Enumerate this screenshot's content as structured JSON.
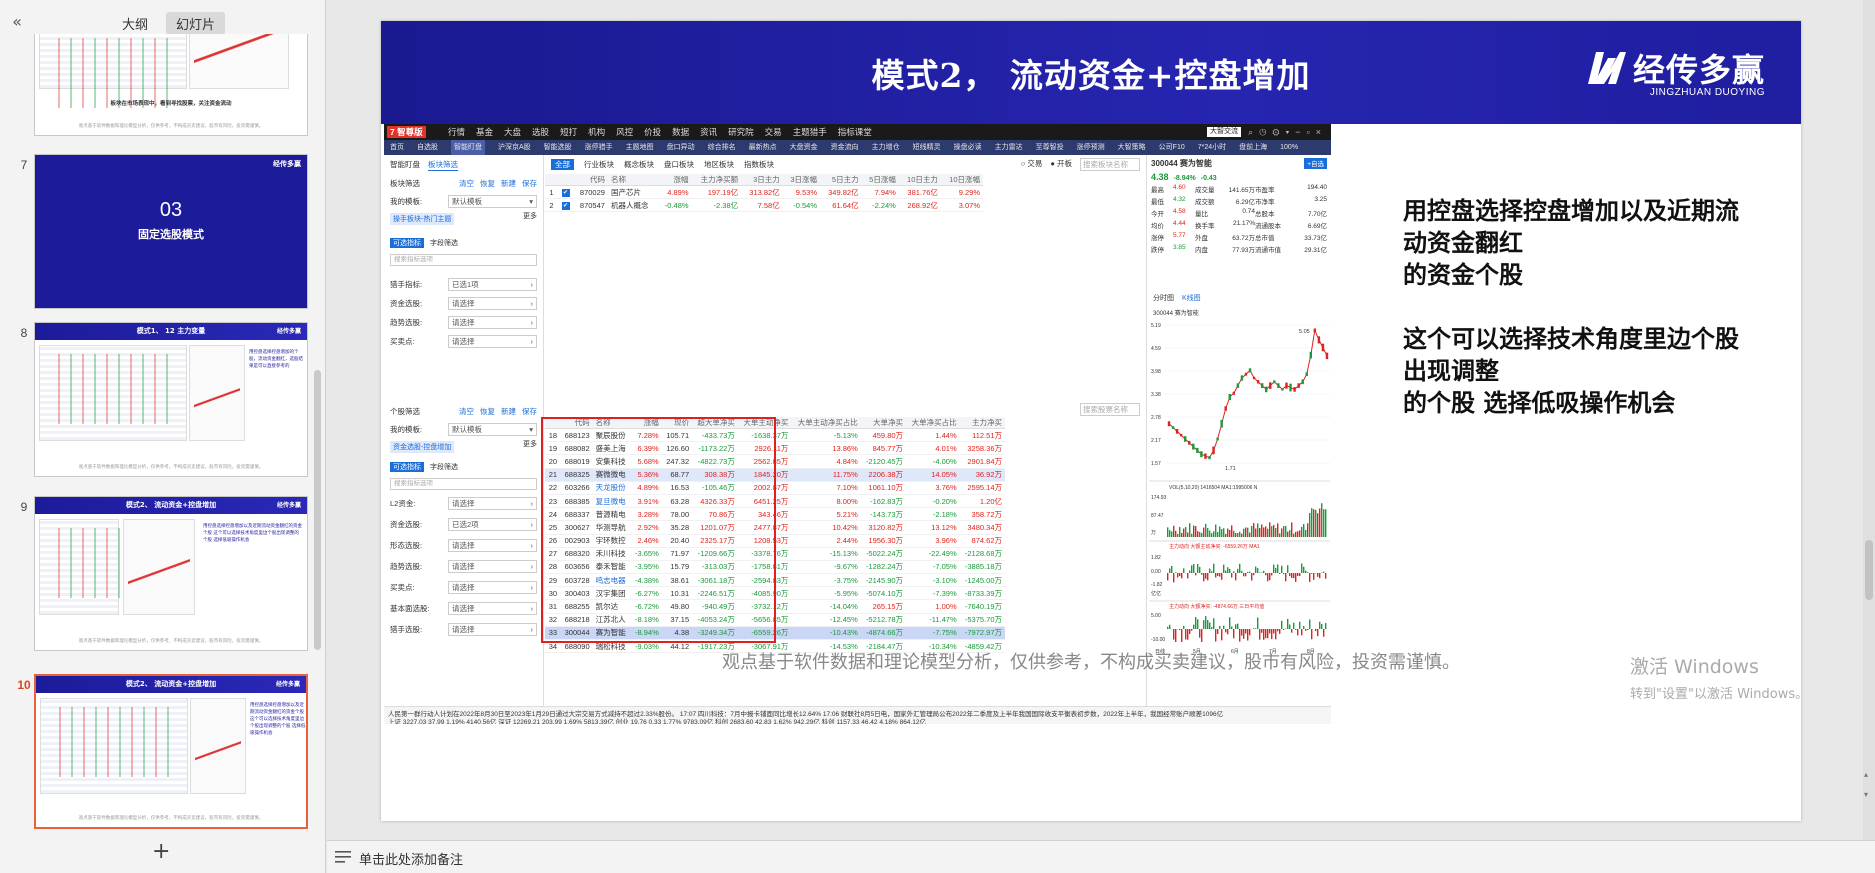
{
  "left_panel": {
    "tabs": [
      {
        "label": "大纲"
      },
      {
        "label": "幻灯片"
      }
    ],
    "thumbs": [
      {
        "num": "",
        "caption": "板块在市场表现中，看到寻找股票，关注资金流动",
        "foot": "观点基于软件数据和理论模型分析，仅供参考，不构成买卖建议，股市有风险，投资需谨慎。"
      },
      {
        "num": "7",
        "big_number": "03",
        "big_title": "固定选股模式",
        "brand": "经传多赢"
      },
      {
        "num": "8",
        "title": "模式1、 12 主力变量",
        "brand": "经传多赢",
        "side_text": "用控盘选择控盘增加的个股，流动资金翻红，选股结果是可以直接参考的",
        "foot": "观点基于软件数据和理论模型分析，仅供参考，不构成买卖建议，股市有风险，投资需谨慎。"
      },
      {
        "num": "9",
        "title": "模式2、 流动资金+控盘增加",
        "brand": "经传多赢",
        "side_text": "用控盘选择控盘增加以及近期流动资金翻红的资金个股 这个可以选择技术角度里边个股出现调整的个股 选择低吸操作机会",
        "foot": "观点基于软件数据和理论模型分析，仅供参考，不构成买卖建议，股市有风险，投资需谨慎。"
      },
      {
        "num": "10",
        "title": "模式2、 流动资金+控盘增加",
        "brand": "经传多赢",
        "side_text": "用控盘选择控盘增加以及近期流动资金翻红的资金个股 这个可以选择技术角度里边个股出现调整的个股 选择低吸操作机会",
        "foot": "观点基于软件数据和理论模型分析，仅供参考，不构成买卖建议，股市有风险，投资需谨慎。"
      }
    ],
    "add_slide": "+",
    "collapse": "«"
  },
  "slide": {
    "title": "模式2，  流动资金+控盘增加",
    "brand_cn": "经传多赢",
    "brand_en": "JINGZHUAN DUOYING",
    "text_p1": [
      "用控盘选择控盘增加以及近期流",
      "动资金翻红",
      "的资金个股"
    ],
    "text_p2": [
      "这个可以选择技术角度里边个股",
      "出现调整",
      "的个股  选择低吸操作机会"
    ],
    "disclaimer": "观点基于软件数据和理论模型分析，仅供参考，不构成买卖建议，股市有风险，投资需谨慎。"
  },
  "software": {
    "logo": "7 智尊版",
    "menu": [
      "行情",
      "基金",
      "大盘",
      "选股",
      "短打",
      "机构",
      "风控",
      "价投",
      "数据",
      "资讯",
      "研究院",
      "交易",
      "主题猎手",
      "指标课堂"
    ],
    "badge": "大智交流",
    "toolbar": [
      "首页",
      "自选股",
      "智能盯盘",
      "沪深京A股",
      "智能选股",
      "涨停猎手",
      "主题地图",
      "盘口异动",
      "综合排名",
      "最新热点",
      "大盘资金",
      "资金流向",
      "主力增仓",
      "短线精灵",
      "操盘必读",
      "主力雷达",
      "至尊智投",
      "涨停预测",
      "大智策略",
      "公司F10",
      "7*24小时",
      "盘前上海",
      "100%"
    ],
    "left_subtabs": [
      "智能盯盘",
      "板块筛选"
    ],
    "sector_section": {
      "title": "板块筛选",
      "links": [
        "清空",
        "恢复",
        "新建",
        "保存"
      ]
    },
    "my_template_label": "我的模板:",
    "my_template_value": "默认模板",
    "more": "更多",
    "sector_tag": "操手板块-热门主题",
    "indicator_tabs": [
      "可选指标",
      "字段筛选"
    ],
    "search_ph": "搜索指标选项",
    "sector_fields": [
      {
        "label": "猎手指标:",
        "value": "已选1项"
      },
      {
        "label": "资金选股:",
        "value": "请选择"
      },
      {
        "label": "趋势选股:",
        "value": "请选择"
      },
      {
        "label": "买卖点:",
        "value": "请选择"
      }
    ],
    "stock_section": {
      "title": "个股筛选",
      "links": [
        "清空",
        "恢复",
        "新建",
        "保存"
      ]
    },
    "stock_tag": "资金选股-控盘增加",
    "stock_fields": [
      {
        "label": "L2资金:",
        "value": "请选择"
      },
      {
        "label": "资金选股:",
        "value": "已选2项"
      },
      {
        "label": "形态选股:",
        "value": "请选择"
      },
      {
        "label": "趋势选股:",
        "value": "请选择"
      },
      {
        "label": "买卖点:",
        "value": "请选择"
      },
      {
        "label": "基本面选股:",
        "value": "请选择"
      },
      {
        "label": "猎手选股:",
        "value": "请选择"
      }
    ],
    "center_tabs": [
      "全部",
      "行业板块",
      "概念板块",
      "盘口板块",
      "地区板块",
      "指数板块"
    ],
    "center_radios": [
      "交易",
      "开板"
    ],
    "center_search": "搜索板块名称",
    "sector_headers": [
      "",
      "",
      "代码",
      "名称",
      "涨幅",
      "主力净买额",
      "3日主力",
      "3日涨幅",
      "5日主力",
      "5日涨幅",
      "10日主力",
      "10日涨幅"
    ],
    "sector_rows": [
      [
        "1",
        "✔",
        "870029",
        "国产芯片",
        "4.89%",
        "197.19亿",
        "313.82亿",
        "9.53%",
        "349.82亿",
        "7.94%",
        "381.76亿",
        "9.29%"
      ],
      [
        "2",
        "✔",
        "870547",
        "机器人概念",
        "-0.48%",
        "-2.38亿",
        "7.58亿",
        "-0.54%",
        "61.64亿",
        "-2.24%",
        "268.92亿",
        "3.07%"
      ]
    ],
    "stock_search": "搜索股票名称",
    "stock_headers": [
      "",
      "代码",
      "名称",
      "涨幅",
      "现价",
      "超大单净买",
      "大单主动净买",
      "大单主动净买占比",
      "大单净买",
      "大单净买占比",
      "主力净买"
    ],
    "stock_rows": [
      [
        "18",
        "688123",
        "聚辰股份",
        "7.28%",
        "105.71",
        "-433.73万",
        "-1638.37万",
        "-5.13%",
        "459.80万",
        "1.44%",
        "112.51万"
      ],
      [
        "19",
        "688082",
        "盛美上海",
        "6.39%",
        "126.60",
        "-1173.22万",
        "2926.11万",
        "13.86%",
        "845.77万",
        "4.01%",
        "3258.36万"
      ],
      [
        "20",
        "688019",
        "安集科技",
        "5.68%",
        "247.32",
        "-4822.73万",
        "2562.85万",
        "4.84%",
        "-2120.45万",
        "-4.00%",
        "2901.84万"
      ],
      [
        "21",
        "688325",
        "赛微微电",
        "5.36%",
        "68.77",
        "308.38万",
        "1845.20万",
        "11.75%",
        "2206.38万",
        "14.05%",
        "36.92万"
      ],
      [
        "22",
        "603266",
        "天龙股份",
        "4.89%",
        "16.53",
        "-105.46万",
        "2002.87万",
        "7.10%",
        "1061.10万",
        "3.76%",
        "2595.14万"
      ],
      [
        "23",
        "688385",
        "复旦微电",
        "3.91%",
        "63.28",
        "4326.33万",
        "6451.25万",
        "8.00%",
        "-162.83万",
        "-0.20%",
        "1.20亿"
      ],
      [
        "24",
        "688337",
        "普源精电",
        "3.28%",
        "78.00",
        "70.86万",
        "343.46万",
        "5.21%",
        "-143.73万",
        "-2.18%",
        "358.72万"
      ],
      [
        "25",
        "300627",
        "华测导航",
        "2.92%",
        "35.28",
        "1201.07万",
        "2477.87万",
        "10.42%",
        "3120.82万",
        "13.12%",
        "3480.34万"
      ],
      [
        "26",
        "002903",
        "宇环数控",
        "2.46%",
        "20.40",
        "2325.17万",
        "1208.53万",
        "2.44%",
        "1956.30万",
        "3.96%",
        "874.62万"
      ],
      [
        "27",
        "688320",
        "禾川科技",
        "-3.65%",
        "71.97",
        "-1209.66万",
        "-3378.76万",
        "-15.13%",
        "-5022.24万",
        "-22.49%",
        "-2128.68万"
      ],
      [
        "28",
        "603656",
        "泰禾智能",
        "-3.95%",
        "15.79",
        "-313.03万",
        "-1758.81万",
        "-9.67%",
        "-1282.24万",
        "-7.05%",
        "-3885.18万"
      ],
      [
        "29",
        "603728",
        "鸣志电器",
        "-4.38%",
        "38.61",
        "-3061.18万",
        "-2594.83万",
        "-3.75%",
        "-2145.90万",
        "-3.10%",
        "-1245.00万"
      ],
      [
        "30",
        "300403",
        "汉宇集团",
        "-6.27%",
        "10.31",
        "-2246.51万",
        "-4085.90万",
        "-5.95%",
        "-5074.10万",
        "-7.39%",
        "-8733.39万"
      ],
      [
        "31",
        "688255",
        "凯尔达",
        "-6.72%",
        "49.80",
        "-940.49万",
        "-3732.12万",
        "-14.04%",
        "265.15万",
        "1.00%",
        "-7640.19万"
      ],
      [
        "32",
        "688218",
        "江苏北人",
        "-8.18%",
        "37.15",
        "-4053.24万",
        "-5656.85万",
        "-12.45%",
        "-5212.78万",
        "-11.47%",
        "-5375.70万"
      ],
      [
        "33",
        "300044",
        "赛为智能",
        "-8.94%",
        "4.38",
        "-3249.34万",
        "-6559.26万",
        "-10.43%",
        "-4874.66万",
        "-7.75%",
        "-7972.97万"
      ],
      [
        "34",
        "688090",
        "瑞松科技",
        "-9.03%",
        "44.12",
        "-1917.23万",
        "-3067.91万",
        "-14.53%",
        "-2184.47万",
        "-10.34%",
        "-4859.42万"
      ]
    ],
    "quote": {
      "title": "300044 赛为智能",
      "button": "+自选",
      "price": "4.38",
      "chg_pct": "-8.94%",
      "chg": "-0.43",
      "rows": [
        [
          "最高",
          "4.60",
          "成交量",
          "141.65万",
          "市盈率",
          "194.40"
        ],
        [
          "最低",
          "4.32",
          "成交额",
          "6.29亿",
          "市净率",
          "3.25"
        ],
        [
          "今开",
          "4.58",
          "量比",
          "0.74",
          "总股本",
          "7.70亿"
        ],
        [
          "均价",
          "4.44",
          "换手率",
          "21.17%",
          "流通股本",
          "6.69亿"
        ],
        [
          "涨停",
          "5.77",
          "外盘",
          "63.72万",
          "总市值",
          "33.73亿"
        ],
        [
          "跌停",
          "3.85",
          "内盘",
          "77.93万",
          "流通市值",
          "29.31亿"
        ]
      ],
      "chart_tabs": [
        "分时图",
        "K线图"
      ],
      "chart_title": "300044 赛为智能",
      "y_ticks": [
        "5.19",
        "4.59",
        "3.98",
        "3.38",
        "2.78",
        "2.17",
        "1.57"
      ],
      "high_mark": "5.05",
      "low_mark": "1.71",
      "vol_label": "VOL(5,10,20)  1416504  MA1:1995006  N",
      "vol_ticks": [
        "174.93",
        "87.47"
      ],
      "vol_unit": "万",
      "flow1_label": "主力动向  大额主动净买: -6559.26万  MA1",
      "flow1_ticks": [
        "1.82",
        "0.00",
        "-1.82"
      ],
      "flow1_unit": "亿亿",
      "flow2_label": "主力动向  大额净买: -4874.66万  三日平均值",
      "flow2_ticks": [
        "5.00",
        "-10.00"
      ],
      "x_labels": [
        "日线",
        "5月",
        "6月",
        "7月",
        "8月"
      ]
    },
    "status_line1": "人民第一群行动人计划在2022年8月30日至2023年1月29日通过大宗交易方式减持不超过2.33%股份。    17:07 四川科技：7月中报卡铺面同比增长12.64%    17:06 财联社8月5日电，国家外汇管理局公布2022年二季度及上半年我国国际收支平衡表初步数，2022年上半年，我国经常账户顺差1096亿",
    "status_line2": "上证 3227.03  37.99  1.19%  4140.56亿     深证 12269.21  203.99  1.69%  5813.39亿     创业 19.76  0.33  1.77%  9783.09亿     科创 2683.60  42.83  1.62%  942.29亿     科创 1157.33  46.42  4.18%  864.12亿"
  },
  "notes": {
    "placeholder": "单击此处添加备注"
  },
  "watermark": {
    "line1": "激活 Windows",
    "line2": "转到\"设置\"以激活 Windows。"
  }
}
